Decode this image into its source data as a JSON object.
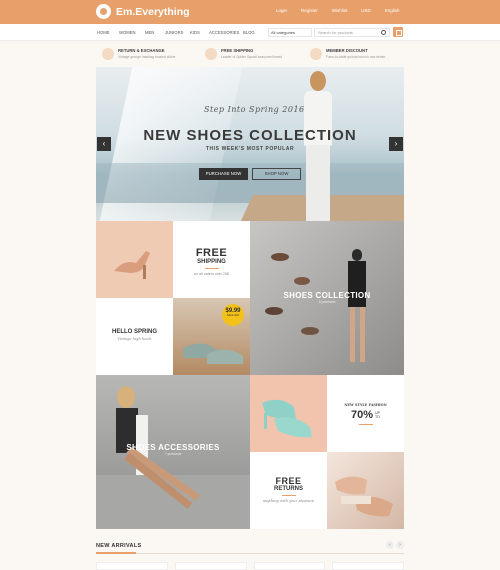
{
  "brand": {
    "name": "Em.Everything"
  },
  "toplinks": [
    "Login",
    "Register",
    "Wishlist",
    "USD",
    "English"
  ],
  "nav": [
    "HOME",
    "WOMEN",
    "MEN",
    "JUNIORS",
    "KIDS",
    "ACCESSORIES",
    "BLOG"
  ],
  "search": {
    "category": "All categories",
    "placeholder": "Search for products"
  },
  "features": [
    {
      "title": "RETURN & EXCHANGE",
      "sub": "Vintage grunge hashtag tousled cliche"
    },
    {
      "title": "FREE SHIPPING",
      "sub": "Leader of Spider Squad seasoned beard"
    },
    {
      "title": "MEMBER DISCOUNT",
      "sub": "Farm-to-table quinoa brunch raw denim"
    }
  ],
  "hero": {
    "tagline": "Step Into Spring 2016",
    "title": "NEW SHOES COLLECTION",
    "subtitle": "THIS WEEK'S MOST POPULAR",
    "btn_purchase": "PURCHASE NOW",
    "btn_shop": "SHOP NOW",
    "prev": "‹",
    "next": "›"
  },
  "tiles": {
    "free_shipping": {
      "title": "FREE",
      "sub": "SHIPPING",
      "note": "on all orders over 20$"
    },
    "hello_spring": {
      "title": "HELLO SPRING",
      "note": "Vintage high heels"
    },
    "price_badge": {
      "price": "$9.99",
      "note": "SALE OFF"
    },
    "shoes_collection": {
      "title": "SHOES COLLECTION",
      "note": "8 products"
    },
    "shoes_accessories": {
      "title": "SHOES ACCESSORIES",
      "note": "7 products"
    },
    "new_style": {
      "label": "NEW STYLE FASHION",
      "percent": "70%",
      "upto_a": "UP",
      "upto_b": "TO"
    },
    "free_returns": {
      "title": "FREE",
      "sub": "RETURNS",
      "note": "anything with your pleasure"
    }
  },
  "arrivals": {
    "title": "NEW ARRIVALS",
    "prev": "‹",
    "next": "›"
  },
  "colors": {
    "accent": "#e8a06b",
    "dark": "#333333",
    "badge": "#f2c21a"
  }
}
